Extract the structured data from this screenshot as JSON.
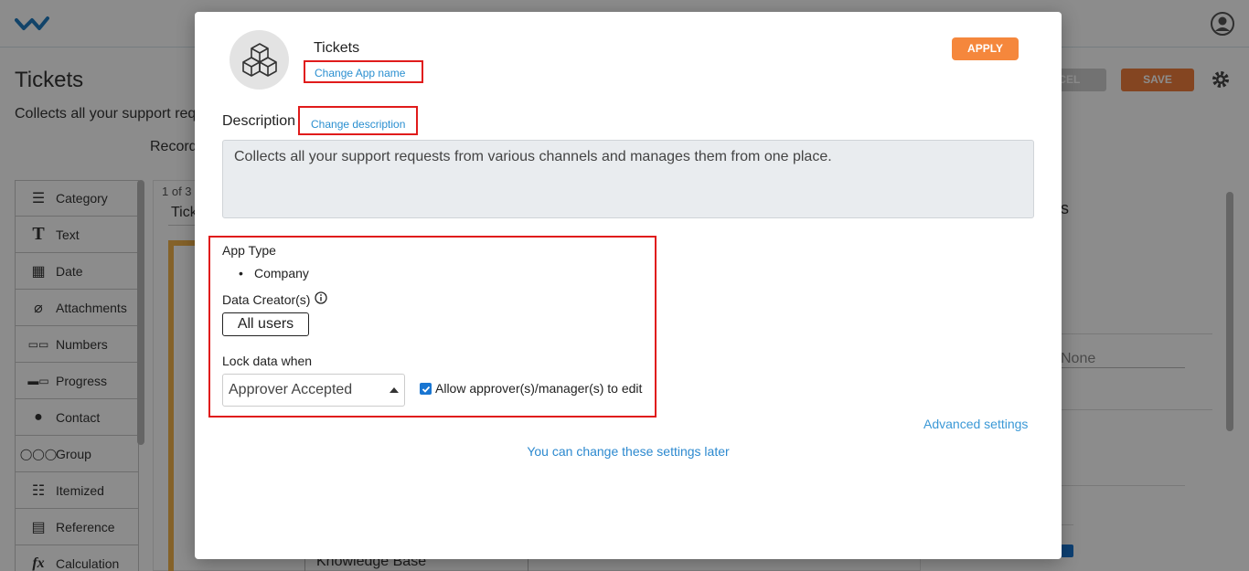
{
  "app": {
    "page_title": "Tickets",
    "page_subtitle": "Collects all your support requ",
    "records_label": "Record",
    "cancel_label": "NCEL",
    "save_label": "SAVE",
    "pager": "1 of 3",
    "tab_label": "Tick",
    "knowledge_base": "Knowledge Base",
    "right_panel_heading": "s",
    "right_panel_select": "None"
  },
  "field_list": {
    "items": [
      {
        "label": "Category",
        "icon": "list-icon"
      },
      {
        "label": "Text",
        "icon": "text-icon"
      },
      {
        "label": "Date",
        "icon": "calendar-icon"
      },
      {
        "label": "Attachments",
        "icon": "paperclip-icon"
      },
      {
        "label": "Numbers",
        "icon": "numbers-icon"
      },
      {
        "label": "Progress",
        "icon": "progress-icon"
      },
      {
        "label": "Contact",
        "icon": "contact-icon"
      },
      {
        "label": "Group",
        "icon": "group-icon"
      },
      {
        "label": "Itemized",
        "icon": "itemized-icon"
      },
      {
        "label": "Reference",
        "icon": "reference-icon"
      },
      {
        "label": "Calculation",
        "icon": "function-icon"
      }
    ]
  },
  "modal": {
    "app_name": "Tickets",
    "change_app_name": "Change App name",
    "apply_label": "APPLY",
    "description_label": "Description",
    "change_description": "Change description",
    "description_text": "Collects all your support requests from various channels and manages them from one place.",
    "app_type_label": "App Type",
    "app_type_value": "Company",
    "data_creators_label": "Data Creator(s)",
    "data_creators_value": "All users",
    "lock_data_label": "Lock data when",
    "lock_data_value": "Approver Accepted",
    "allow_edit_label": "Allow approver(s)/manager(s) to edit",
    "allow_edit_checked": true,
    "advanced_settings": "Advanced settings",
    "change_later": "You can change these settings later"
  },
  "colors": {
    "apply": "#f5873c",
    "save": "#f07f3c",
    "link": "#2a8fd0",
    "highlight_border": "#e01b1b",
    "checkbox": "#1976d2"
  }
}
